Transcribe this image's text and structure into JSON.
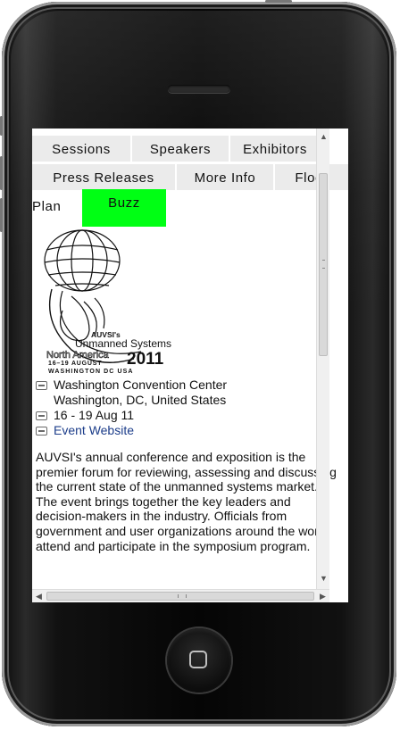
{
  "tabs_row1": [
    "Sessions",
    "Speakers",
    "Exhibitors"
  ],
  "tabs_row2": [
    "Press Releases",
    "More Info",
    "Floor"
  ],
  "tabs_row3": [
    "Plan",
    "Buzz"
  ],
  "active_tab": "Buzz",
  "accent_color": "#00ff14",
  "logo": {
    "brand": "AUVSI's",
    "name": "Unmanned Systems",
    "region": "North America",
    "year": "2011",
    "dates": "16–19 AUGUST",
    "city": "WASHINGTON DC USA"
  },
  "venue": {
    "name": "Washington Convention Center",
    "city": "Washington, DC, United States",
    "dates": "16 - 19 Aug 11",
    "website_label": "Event Website"
  },
  "description": "AUVSI's annual conference and exposition is the premier forum for reviewing, assessing and discussing the current state of the unmanned systems market. The event brings together the key leaders and decision-makers in the industry. Officials from government and user organizations around the world attend and participate in the symposium program.",
  "icons": {
    "venue": "building-icon",
    "dates": "calendar-icon",
    "website": "globe-icon"
  }
}
